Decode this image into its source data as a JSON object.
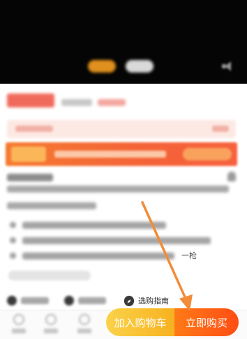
{
  "media": {
    "mode_pill_active": "",
    "mode_pill_inactive": "",
    "volume_icon": "volume-icon"
  },
  "product": {
    "price": "",
    "reference_price": "",
    "price_tag": ""
  },
  "coupon_bar": {
    "text": "",
    "more": ""
  },
  "promo_banner": {
    "badge": "",
    "text": "",
    "button": ""
  },
  "title": {
    "label": "",
    "share_icon": "share-icon"
  },
  "bullets": [
    {
      "text": "",
      "label": ""
    },
    {
      "text": "",
      "label": ""
    },
    {
      "text": "",
      "label": "一枪"
    }
  ],
  "tags": {
    "items": [
      {
        "icon": "check-circle-icon",
        "label": ""
      },
      {
        "icon": "check-circle-icon",
        "label": ""
      }
    ],
    "guide": {
      "icon": "compass-icon",
      "label": "选购指南"
    }
  },
  "bottom_nav": [
    {
      "icon": "store-icon",
      "label": ""
    },
    {
      "icon": "chat-icon",
      "label": ""
    },
    {
      "icon": "cart-icon",
      "label": ""
    }
  ],
  "actions": {
    "add_to_cart": "加入购物车",
    "buy_now": "立即购买"
  },
  "colors": {
    "cart_gradient_start": "#fbd24a",
    "cart_gradient_end": "#f7b21f",
    "buy_gradient_start": "#ff7a17",
    "buy_gradient_end": "#ff4d14",
    "annotation_arrow": "#f28c38",
    "promo_banner": "#f46437"
  }
}
